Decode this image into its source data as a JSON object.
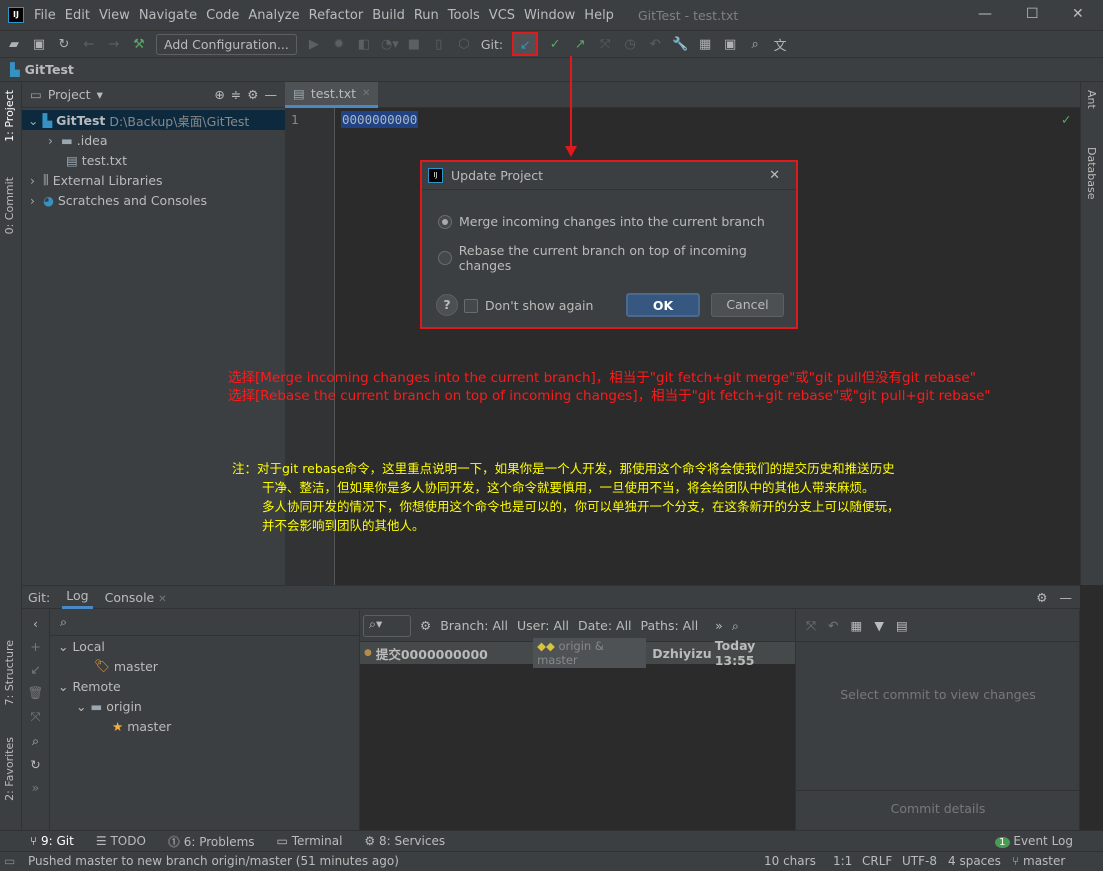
{
  "window": {
    "title": "GitTest - test.txt",
    "logo": "IJ"
  },
  "menu": [
    "File",
    "Edit",
    "View",
    "Navigate",
    "Code",
    "Analyze",
    "Refactor",
    "Build",
    "Run",
    "Tools",
    "VCS",
    "Window",
    "Help"
  ],
  "toolbar": {
    "add_configuration": "Add Configuration...",
    "git_label": "Git:"
  },
  "navbar": {
    "project": "GitTest"
  },
  "left_strip": {
    "project": "1: Project",
    "commit": "0: Commit",
    "structure": "7: Structure",
    "favorites": "2: Favorites"
  },
  "right_strip": {
    "ant": "Ant",
    "database": "Database"
  },
  "project_panel": {
    "title": "Project",
    "root_name": "GitTest",
    "root_path": "D:\\Backup\\桌面\\GitTest",
    "items": [
      ".idea",
      "test.txt",
      "External Libraries",
      "Scratches and Consoles"
    ]
  },
  "editor": {
    "tab": "test.txt",
    "line_number": "1",
    "content": "0000000000"
  },
  "dialog": {
    "title": "Update Project",
    "option_merge": "Merge incoming changes into the current branch",
    "option_rebase": "Rebase the current branch on top of incoming changes",
    "selected": "merge",
    "dont_show": "Don't show again",
    "ok": "OK",
    "cancel": "Cancel",
    "help": "?"
  },
  "annotations": {
    "red": [
      "选择[Merge incoming changes into the current branch]，相当于\"git fetch+git merge\"或\"git pull但没有git rebase\"",
      "选择[Rebase the current branch on top of incoming changes]，相当于\"git fetch+git rebase\"或\"git pull+git rebase\""
    ],
    "yellow": [
      "注：对于git rebase命令，这里重点说明一下，如果你是一个人开发，那使用这个命令将会使我们的提交历史和推送历史",
      "干净、整洁，但如果你是多人协同开发，这个命令就要慎用，一旦使用不当，将会给团队中的其他人带来麻烦。",
      "多人协同开发的情况下，你想使用这个命令也是可以的，你可以单独开一个分支，在这条新开的分支上可以随便玩，",
      "并不会影响到团队的其他人。"
    ]
  },
  "git_panel": {
    "label": "Git:",
    "tabs": [
      "Log",
      "Console"
    ],
    "branches": {
      "local": "Local",
      "local_master": "master",
      "remote": "Remote",
      "origin": "origin",
      "remote_master": "master"
    },
    "filters": {
      "branch": "Branch: All",
      "user": "User: All",
      "date": "Date: All",
      "paths": "Paths: All"
    },
    "commits": [
      {
        "message": "提交0000000000",
        "refs": "origin & master",
        "author": "Dzhiyizu",
        "date": "Today 13:55"
      }
    ],
    "details": {
      "select": "Select commit to view changes",
      "commit_details": "Commit details"
    }
  },
  "bottom_tabs": [
    "9: Git",
    "TODO",
    "6: Problems",
    "Terminal",
    "8: Services"
  ],
  "event_log": {
    "count": "1",
    "label": "Event Log"
  },
  "status": {
    "message": "Pushed master to new branch origin/master (51 minutes ago)",
    "chars": "10 chars",
    "position": "1:1",
    "line_sep": "CRLF",
    "encoding": "UTF-8",
    "indent": "4 spaces",
    "branch": "master"
  }
}
